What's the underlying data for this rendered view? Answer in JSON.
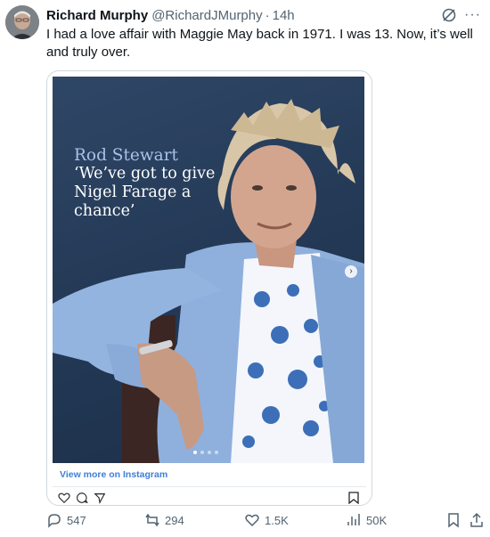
{
  "author": {
    "name": "Richard Murphy",
    "handle": "@RichardJMurphy",
    "separator": "·",
    "time": "14h"
  },
  "tweet": {
    "text": "I had a love affair with Maggie May back in 1971. I was 13. Now, it’s well and truly over."
  },
  "embed": {
    "headline_kicker": "Rod Stewart",
    "headline_quote": "‘We’ve got to give Nigel Farage a chance’",
    "view_more": "View more on Instagram",
    "carousel_count": 4,
    "carousel_active": 0
  },
  "actions": {
    "replies": "547",
    "reposts": "294",
    "likes": "1.5K",
    "views": "50K"
  },
  "colors": {
    "link": "#3f7fd6",
    "muted": "#536471",
    "photo_bg": "#243a57",
    "kicker": "#a9c2e8"
  },
  "icons": [
    "grok-icon",
    "more-icon",
    "reply-icon",
    "repost-icon",
    "like-icon",
    "views-icon",
    "bookmark-icon",
    "share-icon"
  ]
}
